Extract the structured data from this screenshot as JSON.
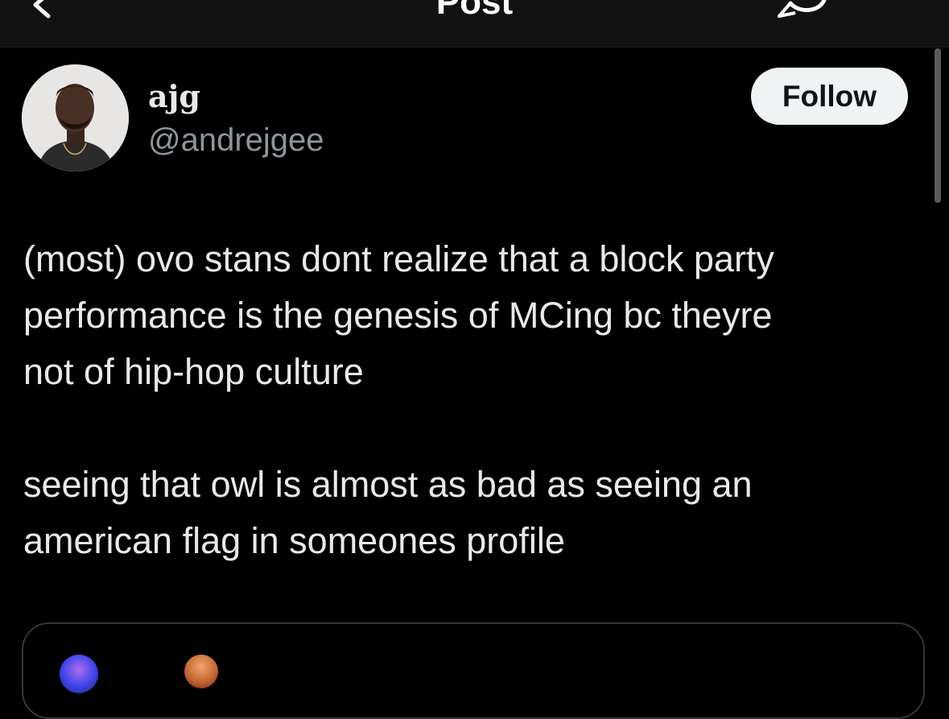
{
  "header": {
    "title": "Post",
    "back_icon": "chevron-left-icon",
    "action_icon": "reply-icon"
  },
  "post": {
    "author_name": "ajg",
    "author_handle": "@andrejgee",
    "follow_label": "Follow",
    "paragraphs": [
      "(most) ovo stans dont realize that a block party\nperformance is the genesis of MCing bc theyre\nnot of hip-hop culture",
      "seeing that owl is almost as bad as seeing an\namerican flag in someones profile"
    ]
  },
  "colors": {
    "background": "#000000",
    "header_bg": "#121212",
    "text_primary": "#e7e9ea",
    "text_secondary": "#8f959b",
    "follow_bg": "#eff3f4",
    "follow_text": "#0f1419",
    "card_border": "#343638"
  }
}
